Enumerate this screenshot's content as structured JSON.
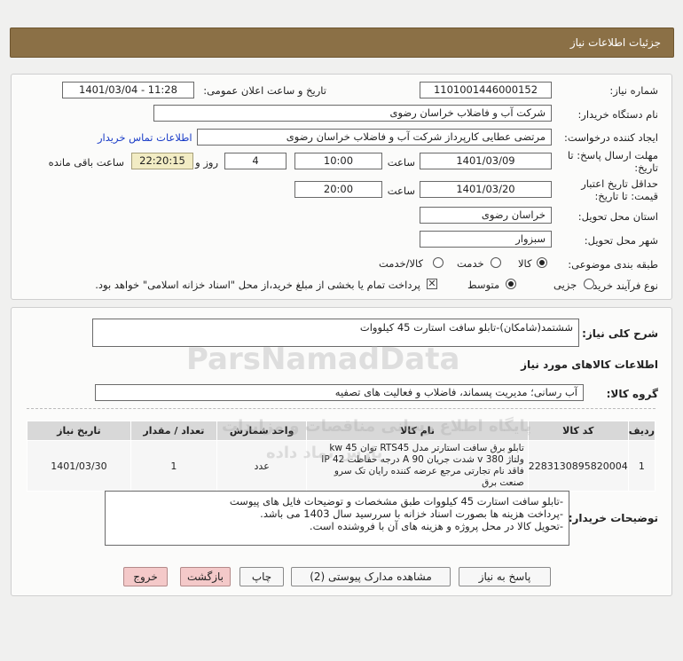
{
  "header": {
    "title": "جزئیات اطلاعات نیاز"
  },
  "fields": {
    "need_number_label": "شماره نیاز:",
    "need_number": "1101001446000152",
    "announce_label": "تاریخ و ساعت اعلان عمومی:",
    "announce_value": "1401/03/04 - 11:28",
    "buyer_org_label": "نام دستگاه خریدار:",
    "buyer_org": "شرکت آب و فاضلاب خراسان رضوی",
    "creator_label": "ایجاد کننده درخواست:",
    "creator": "مرتضی عطایی کارپرداز شرکت آب و فاضلاب خراسان رضوی",
    "contact_link": "اطلاعات تماس خریدار",
    "deadline_label": "مهلت ارسال پاسخ: تا تاریخ:",
    "deadline_date": "1401/03/09",
    "hour_label": "ساعت",
    "deadline_time": "10:00",
    "days_value": "4",
    "days_label": "روز و",
    "remaining_time": "22:20:15",
    "remaining_label": "ساعت باقی مانده",
    "validity_label": "حداقل تاریخ اعتبار قیمت: تا تاریخ:",
    "validity_date": "1401/03/20",
    "validity_time": "20:00",
    "province_label": "استان محل تحویل:",
    "province": "خراسان رضوی",
    "city_label": "شهر محل تحویل:",
    "city": "سبزوار",
    "category_label": "طبقه بندی موضوعی:",
    "category_options": [
      "کالا",
      "خدمت",
      "کالا/خدمت"
    ],
    "process_label": "نوع فرآیند خرید :",
    "process_options": [
      "جزیی",
      "متوسط"
    ],
    "payment_note": "پرداخت تمام یا بخشی از مبلغ خرید،از محل \"اسناد خزانه اسلامی\" خواهد بود."
  },
  "summary": {
    "label": "شرح کلی نیاز:",
    "value": "ششتمد(شامکان)-تابلو سافت استارت 45 کیلووات"
  },
  "goods": {
    "section_title": "اطلاعات کالاهای مورد نیاز",
    "group_label": "گروه کالا:",
    "group_value": "آب رسانی؛ مدیریت پسماند، فاضلاب و فعالیت های تصفیه",
    "columns": [
      "ردیف",
      "کد کالا",
      "نام کالا",
      "واحد شمارش",
      "تعداد / مقدار",
      "تاریخ نیاز"
    ],
    "rows": [
      {
        "row": "1",
        "code": "2283130895820004",
        "name": "تابلو برق سافت استارتر مدل RTS45 توان kw 45 ولتاژ v 380 شدت جریان A 90 درجه حفاظت IP 42 فاقد نام تجارتی مرجع عرضه کننده رایان تک سرو صنعت برق",
        "unit": "عدد",
        "qty": "1",
        "date": "1401/03/30"
      }
    ]
  },
  "buyer_notes": {
    "label": "توضیحات خریدار:",
    "lines": [
      "-تابلو سافت استارت 45 کیلووات طبق مشخصات و توضیحات فایل های پیوست",
      "-پرداخت هزینه ها بصورت اسناد خزانه با سررسید سال 1403 می باشد.",
      "-تحویل کالا در محل پروژه و هزینه های آن با فروشنده است."
    ]
  },
  "buttons": {
    "reply": "پاسخ به نیاز",
    "attachments": "مشاهده مدارک پیوستی (2)",
    "print": "چاپ",
    "back": "بازگشت",
    "exit": "خروج"
  },
  "watermark": {
    "brand": "ParsNamadData",
    "line1": "پایگاه اطلاع رسانی مناقصات و مزایدات",
    "line2": "پارس نماد داده"
  }
}
